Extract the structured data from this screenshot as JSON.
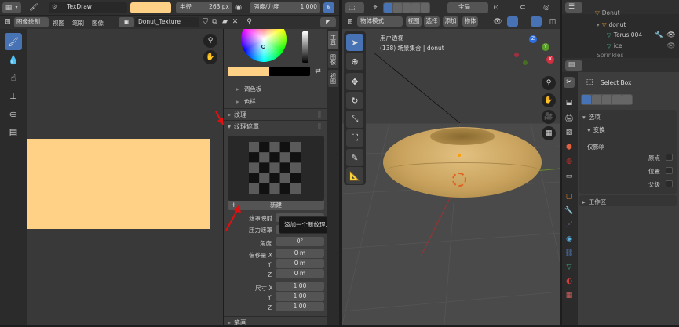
{
  "top_header": {
    "brush_name": "TexDraw",
    "radius_label": "半径",
    "radius_value": "263 px",
    "strength_label": "强度/力度",
    "strength_value": "1.000"
  },
  "image_editor": {
    "mode": "图像绘制",
    "menu": [
      "视图",
      "笔刷",
      "图像"
    ],
    "image_name": "Donut_Texture",
    "canvas_color": "#ffd187"
  },
  "brush_panel": {
    "palette": "调色板",
    "swatches": "色样",
    "texture": "纹理",
    "texture_mask": "纹理遮罩",
    "new_button": "新建",
    "tooltip": "添加一个新纹理.",
    "mask_mapping_label": "遮罩映射",
    "pressure_mask_label": "压力遮罩",
    "angle_label": "角度",
    "angle_value": "0°",
    "offset_label": "偏移量",
    "offset_axes": [
      "X",
      "Y",
      "Z"
    ],
    "offset_values": [
      "0 m",
      "0 m",
      "0 m"
    ],
    "size_label": "尺寸",
    "size_axes": [
      "X",
      "Y",
      "Z"
    ],
    "size_values": [
      "1.00",
      "1.00",
      "1.00"
    ],
    "stroke": "笔画",
    "side_tabs": [
      "工具",
      "图像",
      "视图"
    ]
  },
  "viewport": {
    "mode": "物体模式",
    "menu": [
      "视图",
      "选择",
      "添加",
      "物体"
    ],
    "orientation": "全局",
    "view_name": "用户透视",
    "collection_info": "(138) 场景集合 | donut",
    "axis_labels": [
      "Z",
      "Y",
      "X"
    ]
  },
  "outliner": {
    "items": [
      "Donut",
      "donut",
      "Torus.004",
      "ice",
      "Sprinkles"
    ]
  },
  "properties": {
    "tool_name": "Select Box",
    "options": "选项",
    "transform": "变换",
    "affect_only": "仅影响",
    "checks": [
      "原点",
      "位置",
      "父级"
    ],
    "workspace": "工作区"
  },
  "colors": {
    "accent_blue": "#4772b3",
    "donut": "#c9a35e",
    "annotation_red": "#e01010"
  }
}
